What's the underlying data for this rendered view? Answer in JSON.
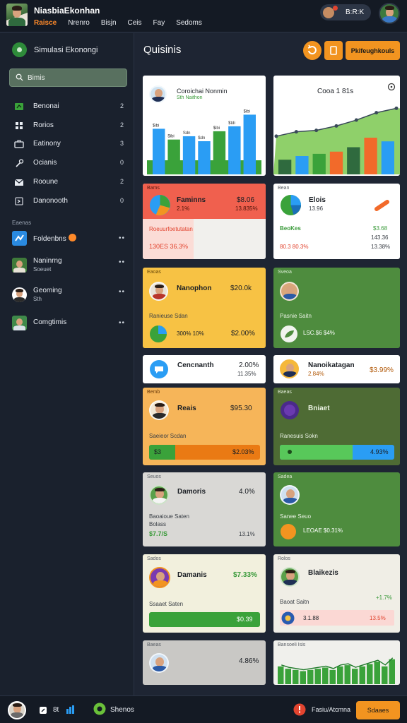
{
  "topbar": {
    "title": "NiasbiaEkonhan",
    "menu": [
      {
        "label": "Raisce",
        "active": true
      },
      {
        "label": "Nrenro",
        "active": false
      },
      {
        "label": "Bisjn",
        "active": false
      },
      {
        "label": "Ceis",
        "active": false
      },
      {
        "label": "Fay",
        "active": false
      },
      {
        "label": "Sedoms",
        "active": false
      }
    ],
    "pill_label": "B:R:K"
  },
  "sidebar": {
    "title": "Simulasi Ekonongi",
    "search_value": "Bimis",
    "items": [
      {
        "label": "Benonai",
        "count": "2",
        "icon": "leaf-icon"
      },
      {
        "label": "Rorios",
        "count": "2",
        "icon": "grid-icon"
      },
      {
        "label": "Eatinony",
        "count": "3",
        "icon": "briefcase-icon"
      },
      {
        "label": "Ocianis",
        "count": "0",
        "icon": "tool-icon"
      },
      {
        "label": "Rooune",
        "count": "2",
        "icon": "mail-icon"
      },
      {
        "label": "Danonooth",
        "count": "0",
        "icon": "chevron-icon"
      }
    ],
    "section_label": "Eaenas",
    "contacts": [
      {
        "name": "Foldenbns",
        "sub": "",
        "more": "••",
        "badge": true
      },
      {
        "name": "Naninrng",
        "sub": "Soeuet",
        "more": "••"
      },
      {
        "name": "Geoming",
        "sub": "Sth",
        "more": "••"
      },
      {
        "name": "Comgtimis",
        "sub": "",
        "more": "••"
      }
    ]
  },
  "main": {
    "title": "Quisinis",
    "cta_label": "Pkifeughkouls"
  },
  "chart_data": [
    {
      "type": "bar",
      "title": "Coroichai Nonmin",
      "subtitle": "Sth Naithon",
      "data_labels": [
        "$ibi",
        "$ibi",
        "Sdn",
        "$dn",
        "$ibi",
        "$tdi",
        "$ibi"
      ],
      "categories": [
        "1",
        "2",
        "3",
        "4",
        "5",
        "6",
        "7"
      ],
      "values": [
        55,
        42,
        46,
        40,
        52,
        58,
        72
      ],
      "ylim": [
        0,
        80
      ]
    },
    {
      "type": "bar",
      "title": "Cooa 1 81s",
      "categories": [
        "1",
        "2",
        "3",
        "4",
        "5",
        "6",
        "7"
      ],
      "values": [
        20,
        25,
        28,
        31,
        37,
        50,
        45
      ],
      "line_values": [
        52,
        58,
        60,
        66,
        74,
        84,
        90
      ],
      "ylim": [
        0,
        100
      ]
    },
    {
      "type": "bar",
      "title": "",
      "categories": [
        "1",
        "2",
        "3",
        "4",
        "5",
        "6",
        "7",
        "8",
        "9",
        "10",
        "11",
        "12",
        "13",
        "14",
        "15",
        "16"
      ],
      "values": [
        30,
        26,
        24,
        22,
        24,
        26,
        28,
        24,
        30,
        32,
        26,
        30,
        34,
        38,
        30,
        42
      ],
      "ylim": [
        0,
        50
      ]
    }
  ],
  "cards": {
    "c3": {
      "header": "Bams",
      "name": "Faminns",
      "val1": "$8.06",
      "pct1": "2.1%",
      "pct2": "13.835%",
      "row2a": "Roeuurfoetutatan",
      "row2b": "130ES 36.3%"
    },
    "c4": {
      "header": "Bean",
      "name": "Elois",
      "sub": "13.96",
      "label_l": "BeoKes",
      "val_r": "$3.68",
      "val_r2": "143.36",
      "row2a": "80.3 80.3%",
      "row2b": "13.38%"
    },
    "c5": {
      "header": "Eaoas",
      "name": "Nanophon",
      "value": "$20.0k",
      "caption": "Ranieuse Sdan",
      "p1": "300% 10%",
      "p2": "$2.00%"
    },
    "c6": {
      "header": "Sveoa",
      "caption": "Pasnie Saitn",
      "caption2": "LSC.$6 $4%"
    },
    "c7": {
      "name": "Cencnanth",
      "pct": "2.00%",
      "sub": "11.35%"
    },
    "c8": {
      "name": "Nanoikatagan",
      "sub": "2.84%",
      "pct": "$3.99%"
    },
    "c9": {
      "header": "Bemb",
      "name": "Reais",
      "value": "$95.30",
      "caption": "Saeieor Scdan",
      "bar_l": "$3",
      "bar_r": "$2.03%"
    },
    "c10": {
      "header": "Baeas",
      "name": "Bniaet",
      "caption": "Ranesuis Sokn",
      "bar_r": "4.93%"
    },
    "c11": {
      "header": "Seuos",
      "name": "Damoris",
      "pct": "4.0%",
      "caption": "Baoaioue Saten",
      "caption2": "Bolass",
      "value": "$7.7/S",
      "pct2": "13.1%"
    },
    "c12": {
      "header": "Sadea",
      "caption": "Sanee Seuo",
      "caption2": "LEOAE $0.31%"
    },
    "c13": {
      "header": "Sados",
      "name": "Damanis",
      "pct": "$7.33%",
      "caption": "Ssaaet Saten",
      "bar_r": "$0.39"
    },
    "c14": {
      "header": "Rolos",
      "name": "Blaikezis",
      "pct": "+1.7%",
      "caption": "Baoat Saitn",
      "val_l": "3.1.88",
      "val_r": "13.5%"
    },
    "c15": {
      "header": "Baeas",
      "pct": "4.86%"
    },
    "c16": {
      "header": "Bansoeli Isis"
    }
  },
  "bottombar": {
    "icon_label": "8t",
    "app_label": "Shenos",
    "status_label": "Fasiu/Atcmna",
    "button_label": "Sdaaes"
  },
  "colors": {
    "accent": "#f29420",
    "green": "#3a9a3a",
    "blue": "#2a9df4",
    "red": "#e24a3b"
  }
}
